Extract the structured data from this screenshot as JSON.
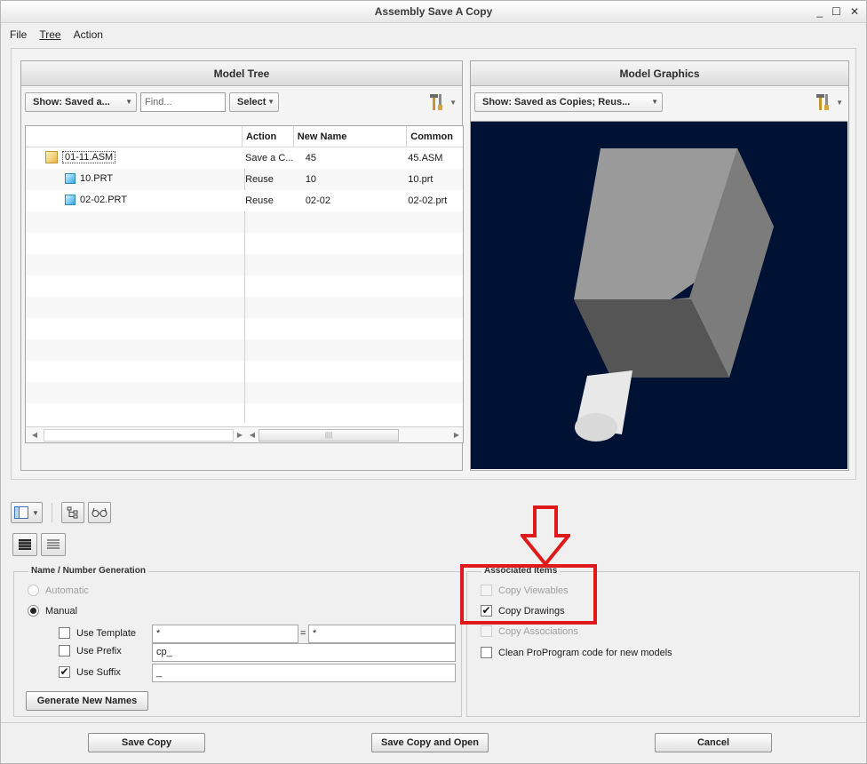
{
  "window": {
    "title": "Assembly Save A Copy",
    "controls": [
      "_",
      "☐",
      "✕"
    ]
  },
  "menu": [
    {
      "label": "File"
    },
    {
      "label": "Tree"
    },
    {
      "label": "Action"
    }
  ],
  "model_tree": {
    "header": "Model Tree",
    "show_combo": "Show: Saved a...",
    "find_placeholder": "Find...",
    "select_label": "Select",
    "columns": [
      "",
      "Action",
      "New Name",
      "Common"
    ],
    "rows": [
      {
        "name": "01-11.ASM",
        "action": "Save a C...",
        "new_name": "45",
        "common": "45.ASM",
        "type": "asm",
        "indent": 0
      },
      {
        "name": "10.PRT",
        "action": "Reuse",
        "new_name": "10",
        "common": "10.prt",
        "type": "prt",
        "indent": 1
      },
      {
        "name": "02-02.PRT",
        "action": "Reuse",
        "new_name": "02-02",
        "common": "02-02.prt",
        "type": "prt",
        "indent": 1
      }
    ]
  },
  "model_graphics": {
    "header": "Model Graphics",
    "show_combo": "Show: Saved as Copies; Reus...",
    "background": "#001233"
  },
  "name_generation": {
    "title": "Name / Number Generation",
    "automatic": "Automatic",
    "manual": "Manual",
    "selected": "manual",
    "use_template": {
      "label": "Use Template",
      "checked": false,
      "value1": "*",
      "equals": "=",
      "value2": "*"
    },
    "use_prefix": {
      "label": "Use Prefix",
      "checked": false,
      "value": "cp_"
    },
    "use_suffix": {
      "label": "Use Suffix",
      "checked": true,
      "value": "_"
    },
    "generate_button": "Generate New Names"
  },
  "associated_items": {
    "title": "Associated Items",
    "copy_viewables": {
      "label": "Copy Viewables",
      "checked": false,
      "enabled": false
    },
    "copy_drawings": {
      "label": "Copy Drawings",
      "checked": true,
      "enabled": true
    },
    "copy_associations": {
      "label": "Copy Associations",
      "checked": false,
      "enabled": false
    },
    "clean_proprogram": {
      "label": "Clean ProProgram code for new models",
      "checked": false,
      "enabled": true
    }
  },
  "footer": {
    "save_copy": "Save Copy",
    "save_copy_and_open": "Save Copy and Open",
    "cancel": "Cancel"
  },
  "annotation_color": "#e01a1a"
}
